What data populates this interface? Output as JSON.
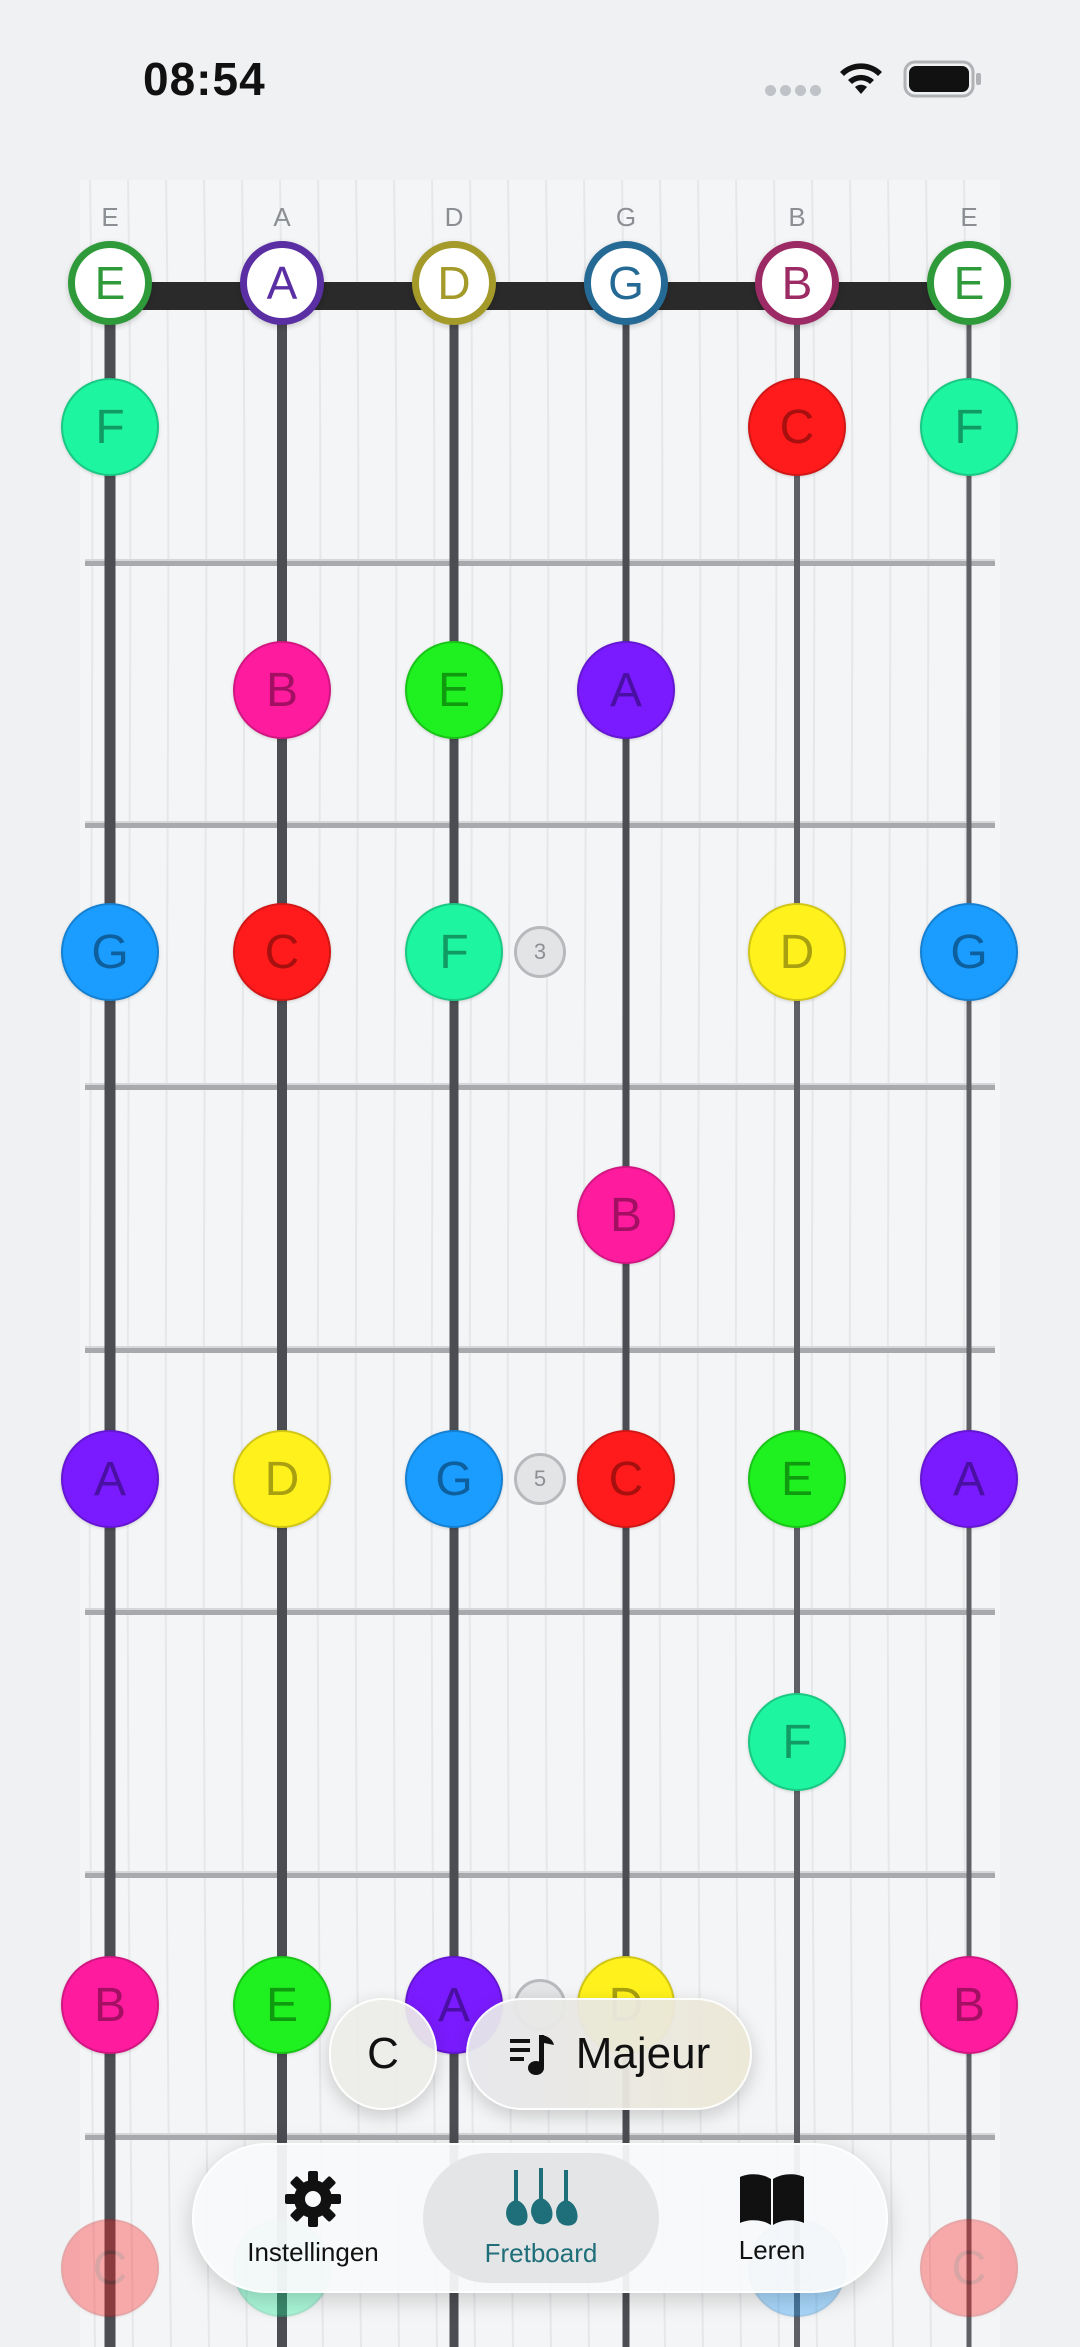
{
  "status_bar": {
    "time": "08:54"
  },
  "strings": {
    "labels": [
      "E",
      "A",
      "D",
      "G",
      "B",
      "E"
    ],
    "open_notes": [
      {
        "note": "E",
        "color": "#2e9a3a"
      },
      {
        "note": "A",
        "color": "#5a2fa3"
      },
      {
        "note": "D",
        "color": "#a39a2a"
      },
      {
        "note": "G",
        "color": "#256a94"
      },
      {
        "note": "B",
        "color": "#9c2a64"
      },
      {
        "note": "E",
        "color": "#2e9a3a"
      }
    ]
  },
  "note_colors": {
    "C": {
      "bg": "#ff1b1b",
      "fg": "#a80f0f"
    },
    "D": {
      "bg": "#fff21c",
      "fg": "#a8a010"
    },
    "E": {
      "bg": "#1ff01f",
      "fg": "#0f9a0f"
    },
    "F": {
      "bg": "#1ef5a0",
      "fg": "#119a64"
    },
    "G": {
      "bg": "#1a9dff",
      "fg": "#0d5f9e"
    },
    "A": {
      "bg": "#7a1bff",
      "fg": "#4a0fa3"
    },
    "B": {
      "bg": "#ff1b9e",
      "fg": "#a30f63"
    }
  },
  "fretboard": {
    "frets": [
      {
        "notes": [
          "F",
          null,
          null,
          null,
          "C",
          "F"
        ]
      },
      {
        "notes": [
          null,
          "B",
          "E",
          "A",
          null,
          null
        ]
      },
      {
        "notes": [
          "G",
          "C",
          "F",
          null,
          "D",
          "G"
        ],
        "marker": "3"
      },
      {
        "notes": [
          null,
          null,
          null,
          "B",
          null,
          null
        ]
      },
      {
        "notes": [
          "A",
          "D",
          "G",
          "C",
          "E",
          "A"
        ],
        "marker": "5"
      },
      {
        "notes": [
          null,
          null,
          null,
          null,
          "F",
          null
        ]
      },
      {
        "notes": [
          "B",
          "E",
          "A",
          "D",
          null,
          "B"
        ],
        "marker": ""
      },
      {
        "notes": [
          "C",
          "F",
          null,
          null,
          "G",
          "C"
        ],
        "faded": true
      }
    ]
  },
  "controls": {
    "root_note": "C",
    "scale_label": "Majeur"
  },
  "tab_bar": {
    "tabs": [
      {
        "label": "Instellingen",
        "icon": "gear-icon"
      },
      {
        "label": "Fretboard",
        "icon": "guitars-icon",
        "active": true
      },
      {
        "label": "Leren",
        "icon": "book-icon"
      }
    ]
  }
}
